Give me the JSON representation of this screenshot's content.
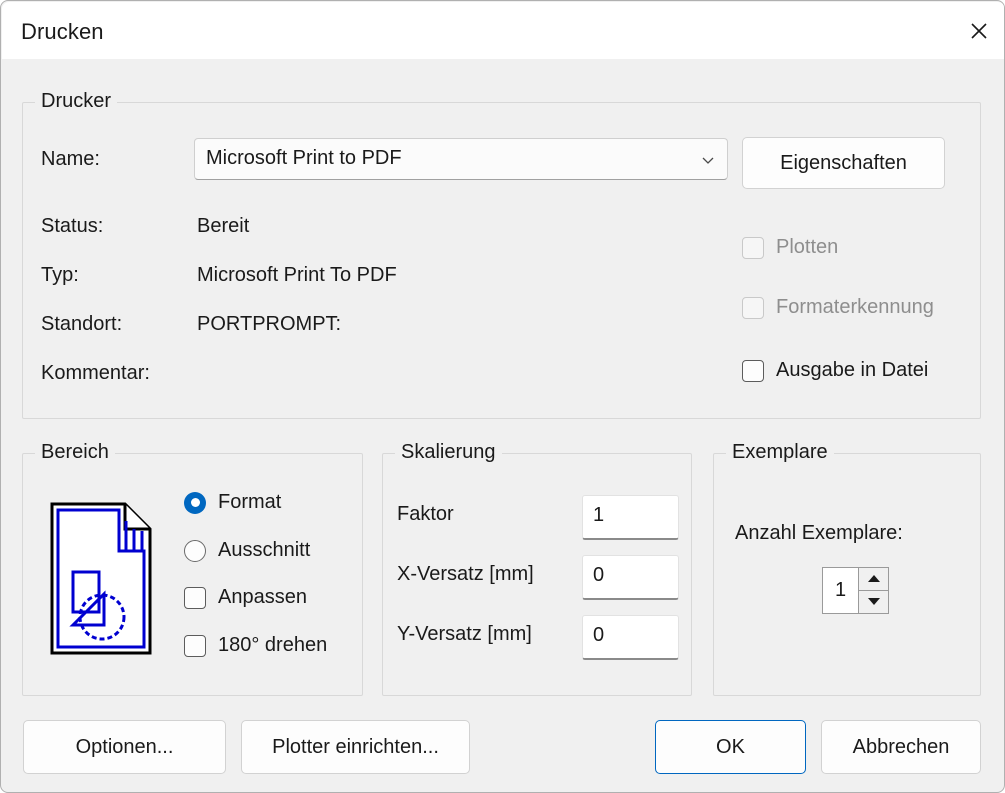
{
  "window": {
    "title": "Drucken",
    "close_icon": "close-icon"
  },
  "printer_group": {
    "legend": "Drucker",
    "name_label": "Name:",
    "selected_printer": "Microsoft Print to PDF",
    "dropdown_icon": "chevron-down-icon",
    "properties_button": "Eigenschaften",
    "status_label": "Status:",
    "status_value": "Bereit",
    "type_label": "Typ:",
    "type_value": "Microsoft Print To PDF",
    "location_label": "Standort:",
    "location_value": "PORTPROMPT:",
    "comment_label": "Kommentar:",
    "comment_value": "",
    "checkboxes": [
      {
        "label": "Plotten",
        "checked": false,
        "enabled": false
      },
      {
        "label": "Formaterkennung",
        "checked": false,
        "enabled": false
      },
      {
        "label": "Ausgabe in Datei",
        "checked": false,
        "enabled": true
      }
    ]
  },
  "range_group": {
    "legend": "Bereich",
    "preview_icon": "page-preview-icon",
    "options": [
      {
        "label": "Format",
        "type": "radio",
        "checked": true
      },
      {
        "label": "Ausschnitt",
        "type": "radio",
        "checked": false
      },
      {
        "label": "Anpassen",
        "type": "checkbox",
        "checked": false
      },
      {
        "label": "180° drehen",
        "type": "checkbox",
        "checked": false
      }
    ]
  },
  "scaling_group": {
    "legend": "Skalierung",
    "fields": [
      {
        "label": "Faktor",
        "value": "1"
      },
      {
        "label": "X-Versatz [mm]",
        "value": "0"
      },
      {
        "label": "Y-Versatz [mm]",
        "value": "0"
      }
    ]
  },
  "copies_group": {
    "legend": "Exemplare",
    "count_label": "Anzahl Exemplare:",
    "count_value": "1",
    "increment_icon": "triangle-up-icon",
    "decrement_icon": "triangle-down-icon"
  },
  "footer": {
    "options_button": "Optionen...",
    "plotter_setup_button": "Plotter einrichten...",
    "ok_button": "OK",
    "cancel_button": "Abbrechen"
  },
  "colors": {
    "accent": "#0067C0",
    "dialog_background": "#F0F0F0",
    "titlebar_background": "#FFFFFF",
    "text": "#1A1A1A",
    "disabled_text": "#8E8E8E",
    "preview_ink": "#0000D0"
  }
}
